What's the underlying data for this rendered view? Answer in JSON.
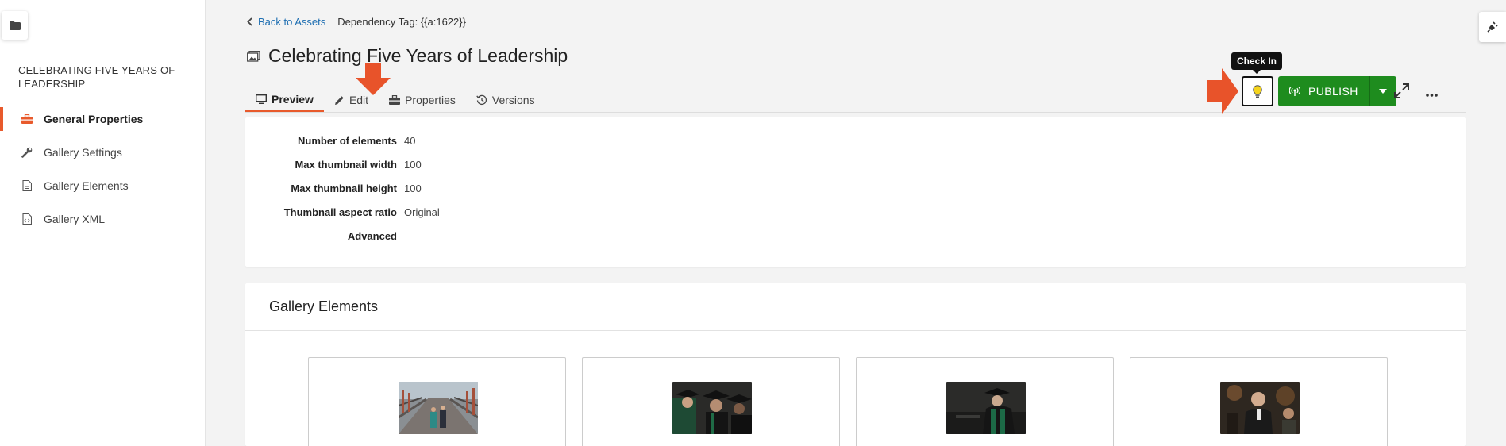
{
  "sidebar": {
    "folder_icon": "folder-icon",
    "title": "CELEBRATING FIVE YEARS OF LEADERSHIP",
    "items": [
      {
        "label": "General Properties",
        "icon": "toolbox-icon",
        "active": true
      },
      {
        "label": "Gallery Settings",
        "icon": "wrench-icon",
        "active": false
      },
      {
        "label": "Gallery Elements",
        "icon": "document-icon",
        "active": false
      },
      {
        "label": "Gallery XML",
        "icon": "code-file-icon",
        "active": false
      }
    ]
  },
  "header": {
    "back_label": "Back to Assets",
    "dependency_tag": "Dependency Tag: {{a:1622}}",
    "title": "Celebrating Five Years of Leadership",
    "title_icon": "gallery-icon"
  },
  "tabs": [
    {
      "label": "Preview",
      "icon": "monitor-icon",
      "active": true
    },
    {
      "label": "Edit",
      "icon": "pencil-icon",
      "active": false
    },
    {
      "label": "Properties",
      "icon": "toolbox-icon",
      "active": false
    },
    {
      "label": "Versions",
      "icon": "history-icon",
      "active": false
    }
  ],
  "toolbar": {
    "tooltip": "Check In",
    "checkin_icon": "lightbulb-icon",
    "publish_label": "PUBLISH",
    "expand_icon": "expand-icon",
    "more_icon": "ellipsis-icon"
  },
  "properties": [
    {
      "label": "Number of elements",
      "value": "40"
    },
    {
      "label": "Max thumbnail width",
      "value": "100"
    },
    {
      "label": "Max thumbnail height",
      "value": "100"
    },
    {
      "label": "Thumbnail aspect ratio",
      "value": "Original"
    },
    {
      "label": "Advanced",
      "value": ""
    }
  ],
  "gallery": {
    "heading": "Gallery Elements",
    "thumbnails": [
      {
        "alt": "people walking on bridge"
      },
      {
        "alt": "graduates in caps and gowns"
      },
      {
        "alt": "speaker in academic regalia"
      },
      {
        "alt": "man speaking at event"
      }
    ]
  },
  "colors": {
    "accent": "#e85a2c",
    "publish": "#1e8c1e",
    "link": "#1f6fb2"
  }
}
